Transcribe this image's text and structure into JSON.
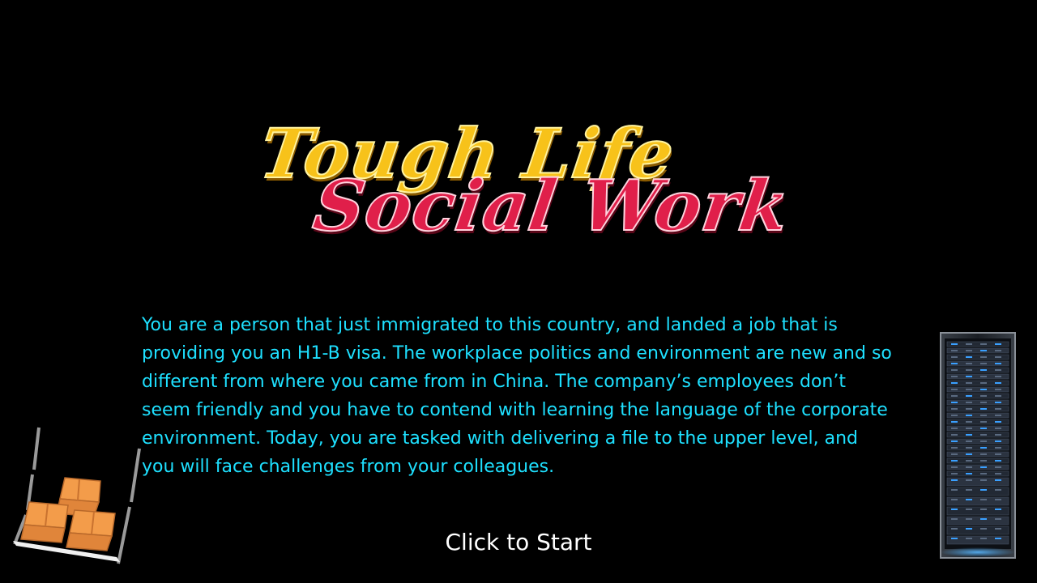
{
  "title": {
    "line1": "Tough Life",
    "line2": "Social Work",
    "line1_color": "#f7c21a",
    "line2_color": "#e01f4a"
  },
  "intro": {
    "text": "You are a person that just immigrated to this country, and landed a job that is providing you an H1-B visa. The workplace politics and environment are new and so different from where you came from in China. The company’s employees don’t seem friendly and you have to contend with learning the language of the corporate environment. Today, you are tasked with delivering a file to the upper level, and you will face challenges from your colleagues.",
    "color": "#1ee0ff"
  },
  "start_button": {
    "label": "Click to Start"
  },
  "graphics": {
    "left": "stacked-boxes-icon",
    "right": "server-rack-icon"
  },
  "colors": {
    "background": "#000000",
    "box_orange": "#f39c4a",
    "server_blue": "#3aa0ff"
  }
}
